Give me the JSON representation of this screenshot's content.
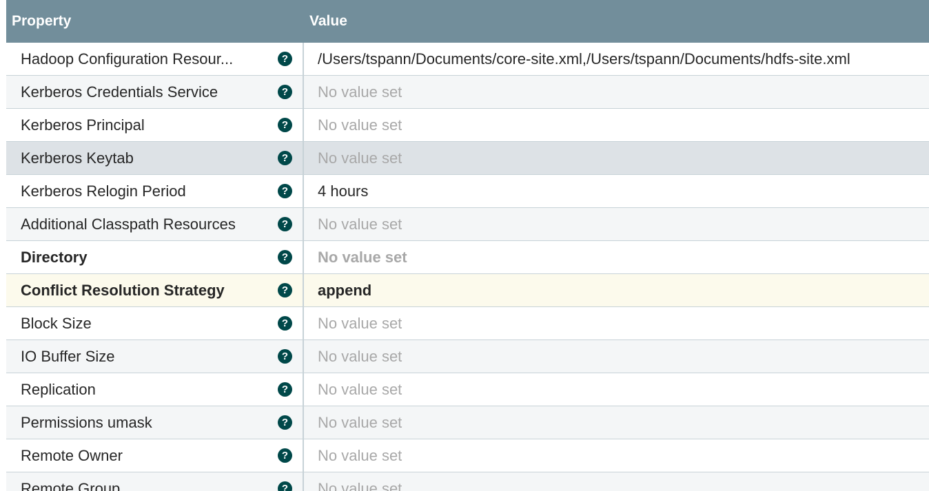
{
  "header": {
    "property_label": "Property",
    "value_label": "Value"
  },
  "rows": [
    {
      "name": "Hadoop Configuration Resour...",
      "value": "/Users/tspann/Documents/core-site.xml,/Users/tspann/Documents/hdfs-site.xml",
      "unset": false,
      "style": "normal",
      "bold": false
    },
    {
      "name": "Kerberos Credentials Service",
      "value": "No value set",
      "unset": true,
      "style": "odd",
      "bold": false
    },
    {
      "name": "Kerberos Principal",
      "value": "No value set",
      "unset": true,
      "style": "normal",
      "bold": false
    },
    {
      "name": "Kerberos Keytab",
      "value": "No value set",
      "unset": true,
      "style": "selected",
      "bold": false
    },
    {
      "name": "Kerberos Relogin Period",
      "value": "4 hours",
      "unset": false,
      "style": "normal",
      "bold": false
    },
    {
      "name": "Additional Classpath Resources",
      "value": "No value set",
      "unset": true,
      "style": "odd",
      "bold": false
    },
    {
      "name": "Directory",
      "value": "No value set",
      "unset": true,
      "style": "normal",
      "bold": true
    },
    {
      "name": "Conflict Resolution Strategy",
      "value": "append",
      "unset": false,
      "style": "highlight",
      "bold": true
    },
    {
      "name": "Block Size",
      "value": "No value set",
      "unset": true,
      "style": "normal",
      "bold": false
    },
    {
      "name": "IO Buffer Size",
      "value": "No value set",
      "unset": true,
      "style": "odd",
      "bold": false
    },
    {
      "name": "Replication",
      "value": "No value set",
      "unset": true,
      "style": "normal",
      "bold": false
    },
    {
      "name": "Permissions umask",
      "value": "No value set",
      "unset": true,
      "style": "odd",
      "bold": false
    },
    {
      "name": "Remote Owner",
      "value": "No value set",
      "unset": true,
      "style": "normal",
      "bold": false
    },
    {
      "name": "Remote Group",
      "value": "No value set",
      "unset": true,
      "style": "odd",
      "bold": false
    }
  ],
  "icons": {
    "help": "question-circle-icon"
  },
  "colors": {
    "header_bg": "#728e9b",
    "help_icon": "#004849",
    "unset_text": "#a8a8a8",
    "highlight_row": "#fcfaec",
    "selected_row": "#dde2e6"
  }
}
